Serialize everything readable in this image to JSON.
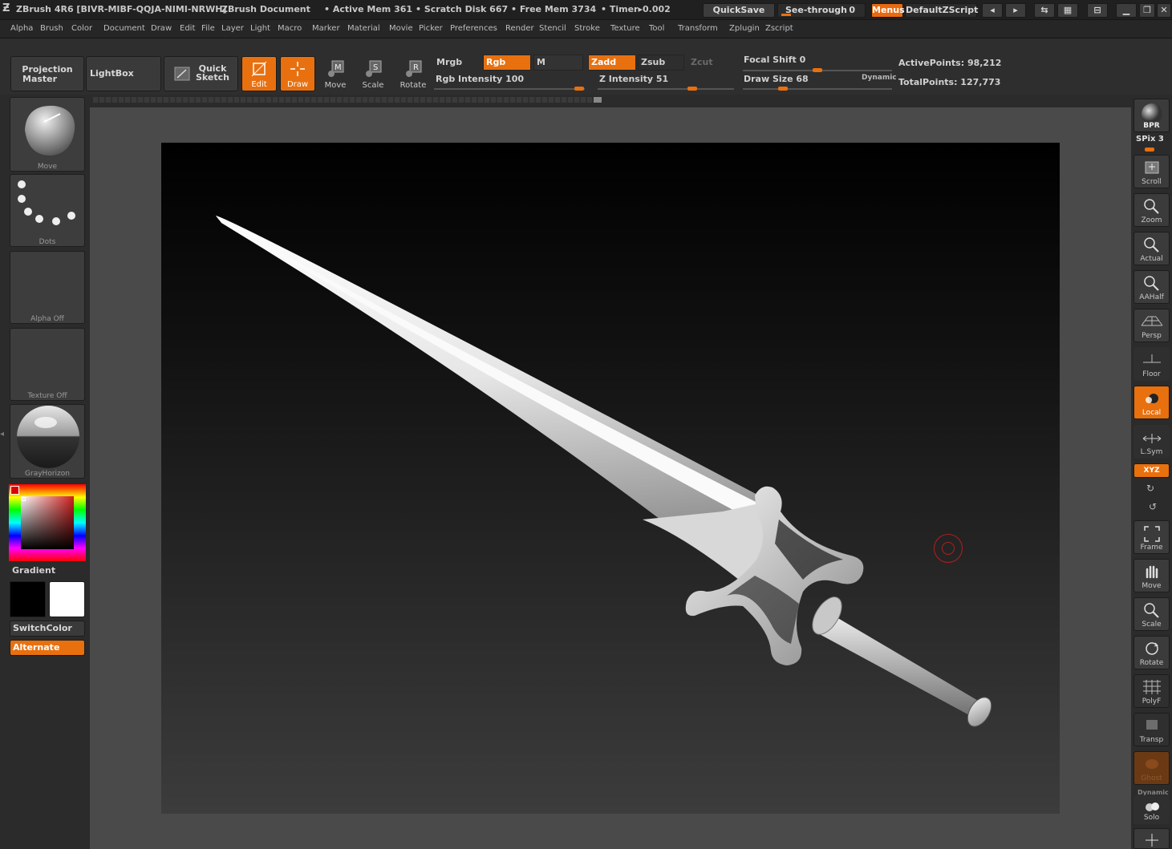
{
  "titlebar": {
    "app": "ZBrush 4R6 [BIVR-MIBF-QQJA-NIMI-NRWH]",
    "document": "ZBrush Document",
    "active_mem": "• Active Mem 361",
    "scratch_disk": "• Scratch Disk 667",
    "free_mem": "• Free Mem 3734",
    "timer": "• Timer▸0.002",
    "quicksave": "QuickSave",
    "see_through_label": "See-through",
    "see_through_value": "0",
    "menus": "Menus",
    "zscript": "DefaultZScript"
  },
  "menubar": [
    "Alpha",
    "Brush",
    "Color",
    "Document",
    "Draw",
    "Edit",
    "File",
    "Layer",
    "Light",
    "Macro",
    "Marker",
    "Material",
    "Movie",
    "Picker",
    "Preferences",
    "Render",
    "Stencil",
    "Stroke",
    "Texture",
    "Tool",
    "Transform",
    "Zplugin",
    "Zscript"
  ],
  "toolbar": {
    "projection_master": [
      "Projection",
      "Master"
    ],
    "lightbox": "LightBox",
    "quick_sketch": [
      "Quick",
      "Sketch"
    ],
    "edit": "Edit",
    "draw": "Draw",
    "move": "Move",
    "scale": "Scale",
    "rotate": "Rotate",
    "mrgb": "Mrgb",
    "rgb": "Rgb",
    "m": "M",
    "zadd": "Zadd",
    "zsub": "Zsub",
    "zcut": "Zcut",
    "rgb_intensity": "Rgb Intensity 100",
    "z_intensity": "Z Intensity 51",
    "focal_shift": "Focal Shift 0",
    "draw_size": "Draw Size 68",
    "dynamic": "Dynamic",
    "active_points": "ActivePoints: 98,212",
    "total_points": "TotalPoints: 127,773"
  },
  "leftshelf": {
    "brush": "Move",
    "stroke": "Dots",
    "alpha": "Alpha  Off",
    "texture": "Texture  Off",
    "material": "GrayHorizon",
    "gradient": "Gradient",
    "switchcolor": "SwitchColor",
    "alternate": "Alternate"
  },
  "rightshelf": {
    "bpr": "BPR",
    "spix": "SPix 3",
    "items": [
      "Scroll",
      "Zoom",
      "Actual",
      "AAHalf",
      "Persp",
      "Floor",
      "Local",
      "L.Sym",
      "XYZ",
      "Frame",
      "Move",
      "Scale",
      "Rotate",
      "PolyF",
      "Transp",
      "Ghost",
      "Solo"
    ],
    "dynamic": "Dynamic"
  },
  "colors": {
    "accent": "#e8700f",
    "panel": "#2b2b2b",
    "button": "#3a3a3a"
  }
}
